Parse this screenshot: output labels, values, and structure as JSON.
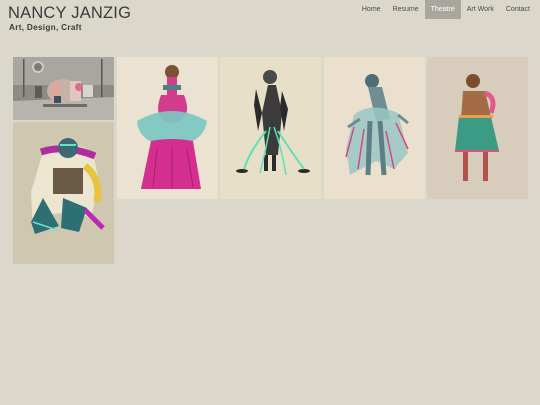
{
  "site": {
    "title": "NANCY JANZIG",
    "tagline": "Art, Design, Craft"
  },
  "nav": {
    "items": [
      {
        "label": "Home",
        "active": false
      },
      {
        "label": "Resume",
        "active": false
      },
      {
        "label": "Theatre",
        "active": true
      },
      {
        "label": "Art Work",
        "active": false
      },
      {
        "label": "Contact",
        "active": false
      }
    ]
  },
  "gallery": {
    "items": [
      {
        "name": "set-model-photo"
      },
      {
        "name": "costume-sketch-crouching-figure"
      },
      {
        "name": "costume-sketch-pink-teal-gown"
      },
      {
        "name": "costume-sketch-standing-figure-green-ribbons"
      },
      {
        "name": "costume-sketch-dancer-tattered-skirt"
      },
      {
        "name": "costume-sketch-figure-green-tunic"
      }
    ]
  },
  "colors": {
    "background": "#dbd8cb",
    "nav_active_bg": "#a9a69d",
    "text": "#3b3b3b"
  }
}
